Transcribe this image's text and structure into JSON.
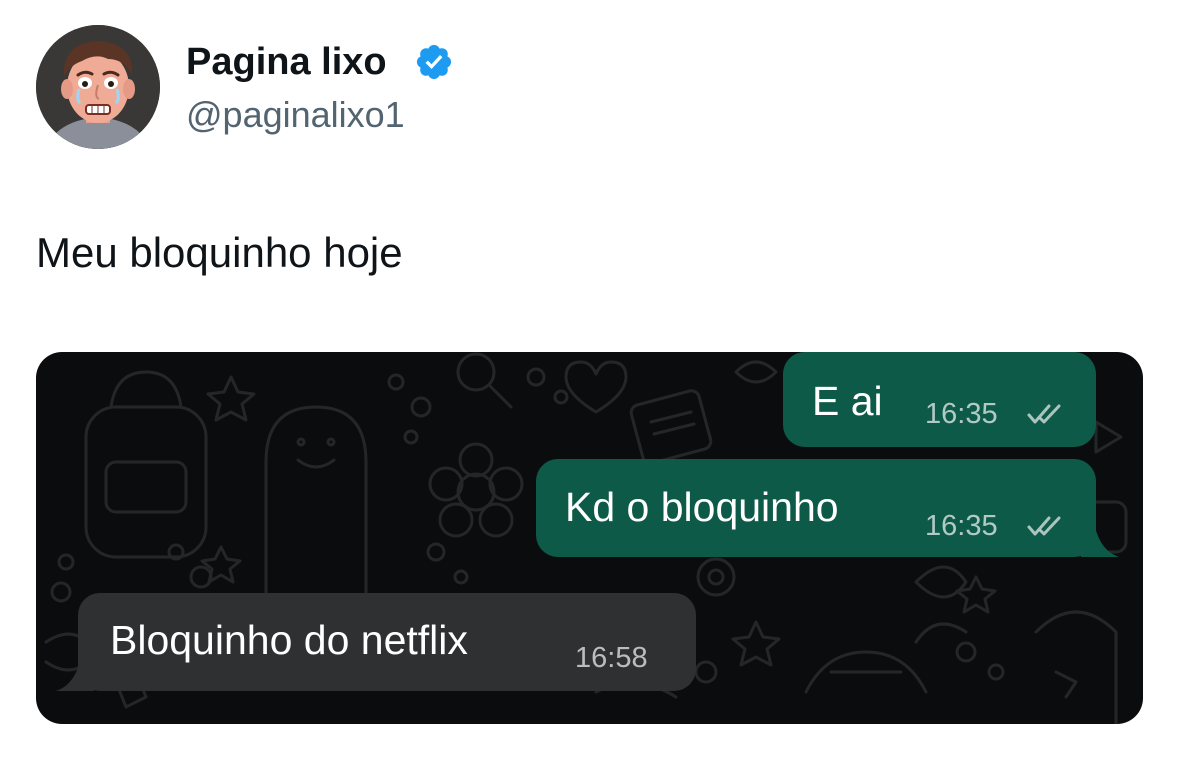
{
  "header": {
    "display_name": "Pagina lixo",
    "handle": "@paginalixo1",
    "avatar_icon": "cartoon-man-crying-avatar",
    "verified_icon": "verified-badge-icon",
    "verified_color": "#1d9bf0"
  },
  "tweet": {
    "text": "Meu bloquinho hoje"
  },
  "chat": {
    "background_color": "#0b0c0d",
    "outgoing_color": "#0e5a48",
    "incoming_color": "#2e3032",
    "messages": [
      {
        "direction": "outgoing",
        "text": "E ai",
        "time": "16:35",
        "status_icon": "double-check-icon"
      },
      {
        "direction": "outgoing",
        "text": "Kd o bloquinho",
        "time": "16:35",
        "status_icon": "double-check-icon"
      },
      {
        "direction": "incoming",
        "text": "Bloquinho do netflix",
        "time": "16:58"
      }
    ]
  }
}
